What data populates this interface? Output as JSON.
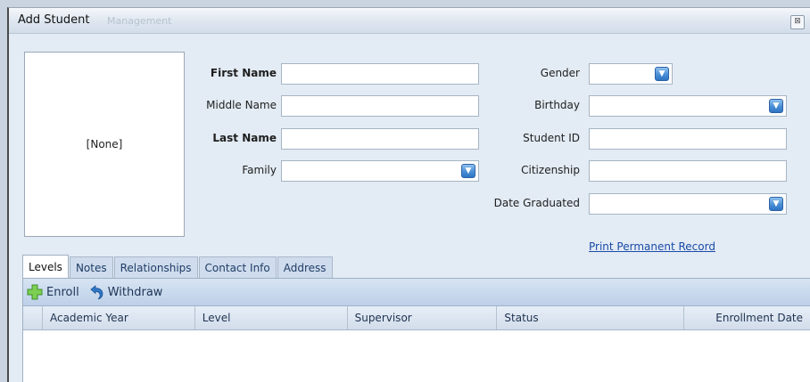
{
  "window": {
    "title": "Add Student",
    "ghost_title": "Management",
    "close_glyph": "⊠"
  },
  "photo": {
    "placeholder": "[None]"
  },
  "form": {
    "first_name_label": "First Name",
    "middle_name_label": "Middle Name",
    "last_name_label": "Last Name",
    "family_label": "Family",
    "gender_label": "Gender",
    "birthday_label": "Birthday",
    "student_id_label": "Student ID",
    "citizenship_label": "Citizenship",
    "date_graduated_label": "Date Graduated",
    "first_name_value": "",
    "middle_name_value": "",
    "last_name_value": "",
    "family_value": "",
    "gender_value": "",
    "birthday_value": "",
    "student_id_value": "",
    "citizenship_value": "",
    "date_graduated_value": ""
  },
  "links": {
    "print_record": "Print Permanent Record"
  },
  "tabs": [
    {
      "label": "Levels",
      "active": true
    },
    {
      "label": "Notes",
      "active": false
    },
    {
      "label": "Relationships",
      "active": false
    },
    {
      "label": "Contact Info",
      "active": false
    },
    {
      "label": "Address",
      "active": false
    }
  ],
  "toolbar": {
    "enroll_label": "Enroll",
    "withdraw_label": "Withdraw",
    "enroll_icon": "plus-icon",
    "withdraw_icon": "undo-arrow-icon"
  },
  "grid": {
    "columns": [
      "Academic Year",
      "Level",
      "Supervisor",
      "Status",
      "Enrollment Date"
    ],
    "rows": []
  },
  "colors": {
    "dropdown_button": "#4a8fd6",
    "enroll_icon": "#6cc24a",
    "withdraw_icon": "#2f78c8",
    "link": "#1a4ba8"
  }
}
